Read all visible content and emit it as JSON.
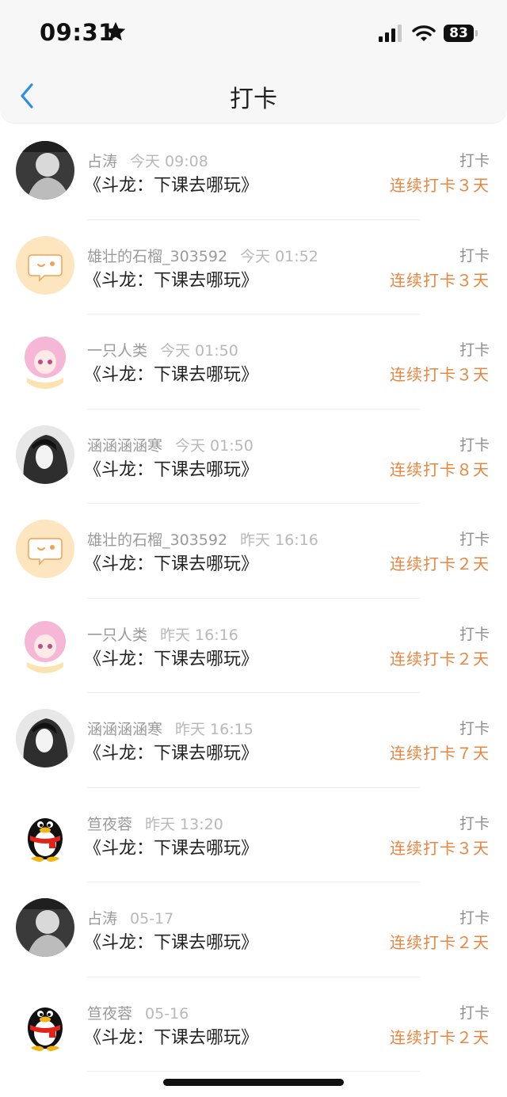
{
  "status_bar": {
    "time": "09:31",
    "battery": "83"
  },
  "header": {
    "title": "打卡"
  },
  "avatar_colors": {
    "speech": "#fde5bf",
    "speech_stroke": "#f2a154",
    "dark": "#2e2e2e",
    "pink": "#f6b6d6"
  },
  "entries": [
    {
      "avatar": "photo-dark",
      "username": "占涛",
      "time": "今天 09:08",
      "book": "《斗龙：下课去哪玩》",
      "action": "打卡",
      "streak": "连续打卡３天"
    },
    {
      "avatar": "speech-bubble",
      "username": "雄壮的石榴_303592",
      "time": "今天 01:52",
      "book": "《斗龙：下课去哪玩》",
      "action": "打卡",
      "streak": "连续打卡３天"
    },
    {
      "avatar": "anime-pink",
      "username": "一只人类",
      "time": "今天 01:50",
      "book": "《斗龙：下课去哪玩》",
      "action": "打卡",
      "streak": "连续打卡３天"
    },
    {
      "avatar": "anime-dark",
      "username": "涵涵涵涵寒",
      "time": "今天 01:50",
      "book": "《斗龙：下课去哪玩》",
      "action": "打卡",
      "streak": "连续打卡８天"
    },
    {
      "avatar": "speech-bubble",
      "username": "雄壮的石榴_303592",
      "time": "昨天 16:16",
      "book": "《斗龙：下课去哪玩》",
      "action": "打卡",
      "streak": "连续打卡２天"
    },
    {
      "avatar": "anime-pink",
      "username": "一只人类",
      "time": "昨天 16:16",
      "book": "《斗龙：下课去哪玩》",
      "action": "打卡",
      "streak": "连续打卡２天"
    },
    {
      "avatar": "anime-dark",
      "username": "涵涵涵涵寒",
      "time": "昨天 16:15",
      "book": "《斗龙：下课去哪玩》",
      "action": "打卡",
      "streak": "连续打卡７天"
    },
    {
      "avatar": "penguin",
      "username": "笪夜蓉",
      "time": "昨天 13:20",
      "book": "《斗龙：下课去哪玩》",
      "action": "打卡",
      "streak": "连续打卡３天"
    },
    {
      "avatar": "photo-dark",
      "username": "占涛",
      "time": "05-17",
      "book": "《斗龙：下课去哪玩》",
      "action": "打卡",
      "streak": "连续打卡２天"
    },
    {
      "avatar": "penguin",
      "username": "笪夜蓉",
      "time": "05-16",
      "book": "《斗龙：下课去哪玩》",
      "action": "打卡",
      "streak": "连续打卡２天"
    }
  ]
}
